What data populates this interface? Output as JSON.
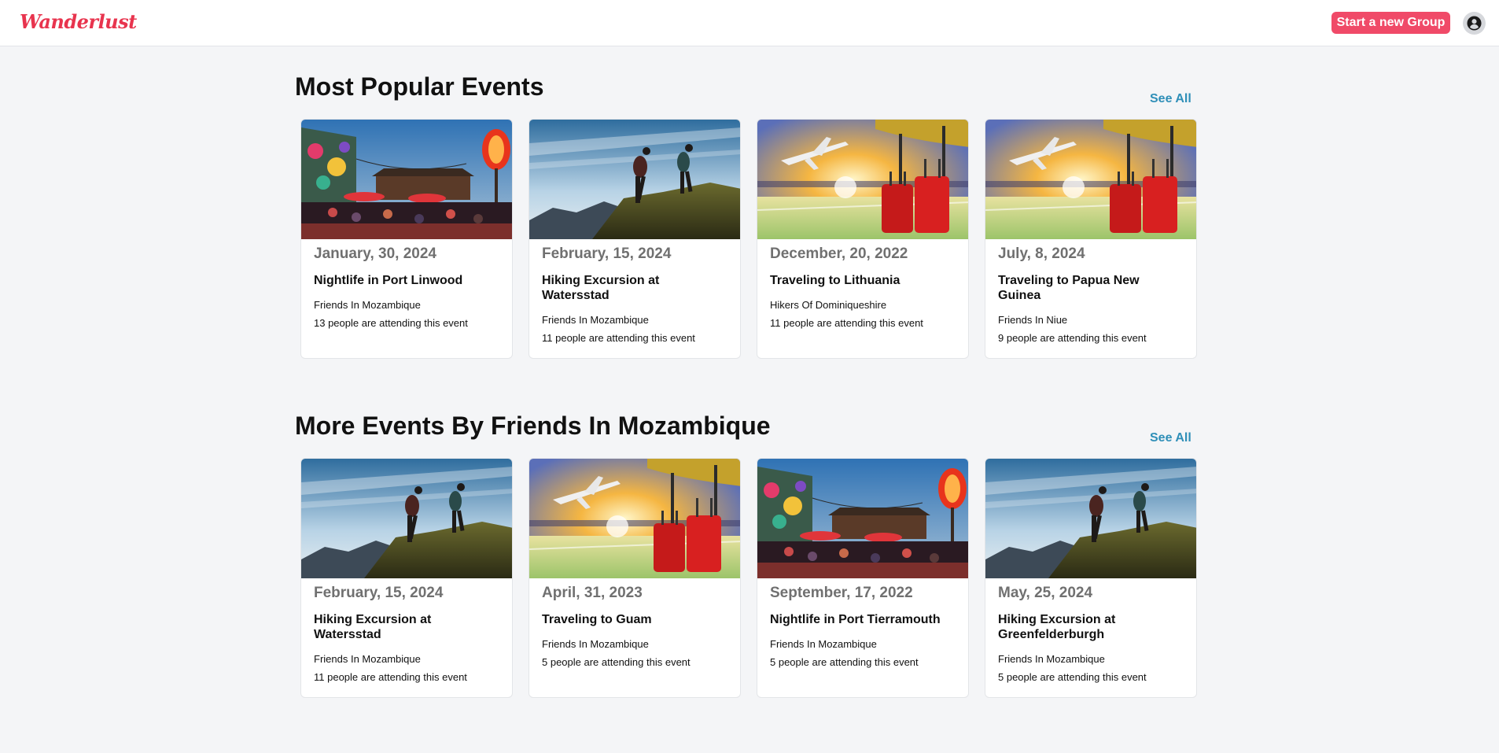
{
  "app": {
    "logo": "Wanderlust"
  },
  "header": {
    "new_group_label": "Start a new Group"
  },
  "sections": [
    {
      "title": "Most Popular Events",
      "see_all": "See All",
      "events": [
        {
          "image": "nightlife",
          "date": "January, 30, 2024",
          "title": "Nightlife in Port Linwood",
          "group": "Friends In Mozambique",
          "attending": "13 people are attending this event"
        },
        {
          "image": "hiking",
          "date": "February, 15, 2024",
          "title": "Hiking Excursion at Watersstad",
          "group": "Friends In Mozambique",
          "attending": "11 people are attending this event"
        },
        {
          "image": "travel",
          "date": "December, 20, 2022",
          "title": "Traveling to Lithuania",
          "group": "Hikers Of Dominiqueshire",
          "attending": "11 people are attending this event"
        },
        {
          "image": "travel",
          "date": "July, 8, 2024",
          "title": "Traveling to Papua New Guinea",
          "group": "Friends In Niue",
          "attending": "9 people are attending this event"
        }
      ]
    },
    {
      "title": "More Events By Friends In Mozambique",
      "see_all": "See All",
      "events": [
        {
          "image": "hiking",
          "date": "February, 15, 2024",
          "title": "Hiking Excursion at Watersstad",
          "group": "Friends In Mozambique",
          "attending": "11 people are attending this event"
        },
        {
          "image": "travel",
          "date": "April, 31, 2023",
          "title": "Traveling to Guam",
          "group": "Friends In Mozambique",
          "attending": "5 people are attending this event"
        },
        {
          "image": "nightlife",
          "date": "September, 17, 2022",
          "title": "Nightlife in Port Tierramouth",
          "group": "Friends In Mozambique",
          "attending": "5 people are attending this event"
        },
        {
          "image": "hiking",
          "date": "May, 25, 2024",
          "title": "Hiking Excursion at Greenfelderburgh",
          "group": "Friends In Mozambique",
          "attending": "5 people are attending this event"
        }
      ]
    }
  ],
  "colors": {
    "brand": "#e8344e",
    "button": "#f04a68",
    "link": "#2f8fb8",
    "background": "#f4f5f7"
  }
}
